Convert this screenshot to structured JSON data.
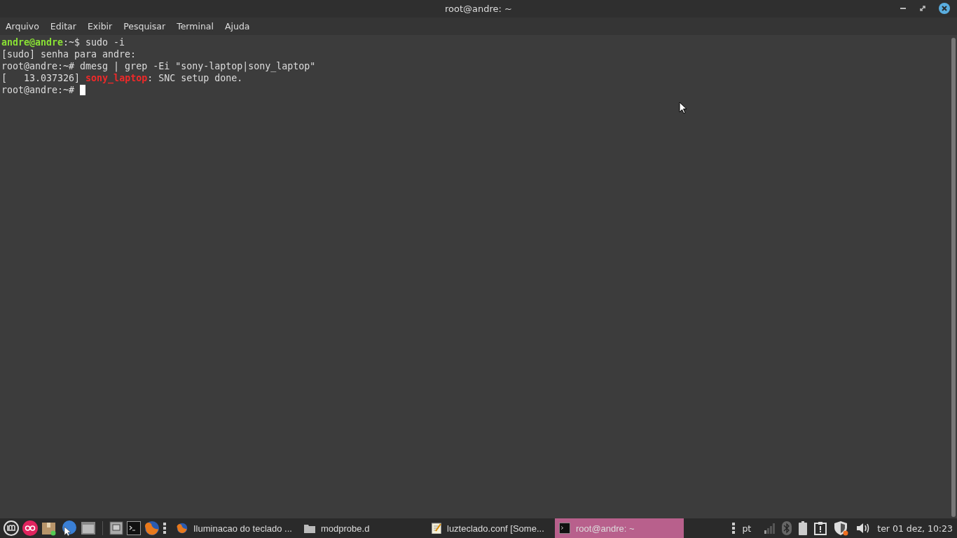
{
  "window": {
    "title": "root@andre: ~"
  },
  "menu": [
    "Arquivo",
    "Editar",
    "Exibir",
    "Pesquisar",
    "Terminal",
    "Ajuda"
  ],
  "terminal": {
    "lines": [
      [
        {
          "kind": "user",
          "text": "andre@andre"
        },
        {
          "kind": "plain",
          "text": ":~$ sudo -i"
        }
      ],
      [
        {
          "kind": "plain",
          "text": "[sudo] senha para andre:"
        }
      ],
      [
        {
          "kind": "plain",
          "text": "root@andre:~# dmesg | grep -Ei \"sony-laptop|sony_laptop\""
        }
      ],
      [
        {
          "kind": "plain",
          "text": "[   13.037326] "
        },
        {
          "kind": "match",
          "text": "sony_laptop"
        },
        {
          "kind": "plain",
          "text": ": SNC setup done."
        }
      ],
      [
        {
          "kind": "plain",
          "text": "root@andre:~# "
        }
      ]
    ],
    "cursor": true
  },
  "taskbar": {
    "windows": [
      {
        "kind": "browser",
        "label": "Iluminacao do teclado ...",
        "selected": false
      },
      {
        "kind": "folder",
        "label": "modprobe.d",
        "selected": false
      },
      {
        "kind": "editor",
        "label": "luzteclado.conf [Some...",
        "selected": false
      },
      {
        "kind": "terminal",
        "label": "root@andre: ~",
        "selected": true
      }
    ],
    "keyboard_layout": "pt",
    "clock": "ter 01 dez, 10:23"
  }
}
